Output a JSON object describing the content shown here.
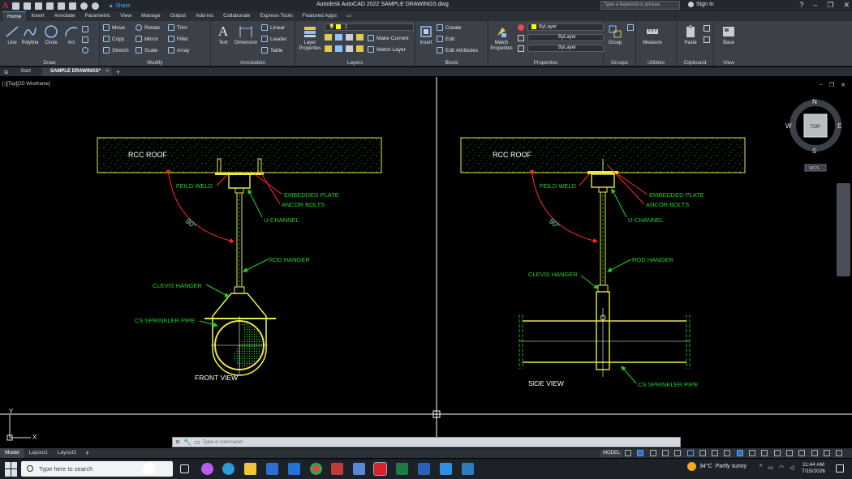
{
  "titlebar": {
    "app_title": "Autodesk AutoCAD 2022    SAMPLE DRAWINGS.dwg",
    "share_label": "Share",
    "search_placeholder": "Type a keyword or phrase",
    "signin_label": "Sign In"
  },
  "ribbon_tabs": [
    "Home",
    "Insert",
    "Annotate",
    "Parametric",
    "View",
    "Manage",
    "Output",
    "Add-ins",
    "Collaborate",
    "Express Tools",
    "Featured Apps"
  ],
  "ribbon": {
    "draw": {
      "title": "Draw",
      "line": "Line",
      "polyline": "Polyline",
      "circle": "Circle",
      "arc": "Arc"
    },
    "modify": {
      "title": "Modify",
      "move": "Move",
      "rotate": "Rotate",
      "trim": "Trim",
      "copy": "Copy",
      "mirror": "Mirror",
      "fillet": "Fillet",
      "stretch": "Stretch",
      "scale": "Scale",
      "array": "Array"
    },
    "annotation": {
      "title": "Annotation",
      "text": "Text",
      "dimension": "Dimension",
      "linear": "Linear",
      "leader": "Leader",
      "table": "Table"
    },
    "layers": {
      "title": "Layers",
      "layer_properties": "Layer Properties",
      "current_layer": "1",
      "make_current": "Make Current",
      "match_layer": "Match Layer"
    },
    "block": {
      "title": "Block",
      "insert": "Insert",
      "create": "Create",
      "edit": "Edit",
      "edit_attributes": "Edit Attributes"
    },
    "properties": {
      "title": "Properties",
      "match_properties": "Match Properties",
      "color": "ByLayer",
      "linetype": "ByLayer",
      "lineweight": "ByLayer"
    },
    "groups": {
      "title": "Groups",
      "group": "Group"
    },
    "utilities": {
      "title": "Utilities",
      "measure": "Measure"
    },
    "clipboard": {
      "title": "Clipboard",
      "paste": "Paste"
    },
    "view": {
      "title": "View",
      "base": "Base"
    }
  },
  "doc_tabs": {
    "start": "Start",
    "active": "SAMPLE DRAWINGS*"
  },
  "viewport_label": "[-][Top][2D Wireframe]",
  "viewcube": {
    "n": "N",
    "s": "S",
    "e": "E",
    "w": "W",
    "face": "TOP",
    "ucs": "WCS"
  },
  "drawing": {
    "roof_label": "RCC ROOF",
    "front": {
      "feild_weld": "FEILD WELD",
      "embedded_plate": "EMBEDDED PLATE",
      "ancor_bolts": "ANCOR BOLTS",
      "u_channel": "U-CHANNEL",
      "angle": "90°",
      "rod_hanger": "ROD HANGER",
      "clevis_hanger": "CLEVIS HANGER",
      "pipe": "CS SPRINKLER PIPE",
      "view_title": "FRONT VIEW"
    },
    "side": {
      "feild_weld": "FEILD WELD",
      "embedded_plate": "EMBEDDED PLATE",
      "ancor_bolts": "ANCOR BOLTS",
      "u_channel": "U-CHANNEL",
      "angle": "90°",
      "rod_hanger": "ROD HANGER",
      "clevis_hanger": "CLEVIS HANGER",
      "pipe": "CS SPRINKLER PIPE",
      "view_title": "SIDE VIEW"
    },
    "ucs_x": "X",
    "ucs_y": "Y"
  },
  "command_line": {
    "placeholder": "Type a command"
  },
  "layout_tabs": [
    "Model",
    "Layout1",
    "Layout2"
  ],
  "status": {
    "model_space": "MODEL"
  },
  "taskbar": {
    "search_placeholder": "Type here to search",
    "temperature": "34°C",
    "weather": "Partly sunny",
    "time": "11:44 AM",
    "date": "7/15/2026"
  },
  "colors": {
    "drawing_green": "#21d421",
    "drawing_yellow": "#e8e84a",
    "leader_red": "#ff2a2a",
    "angle_cyan": "#4ee8e8"
  }
}
